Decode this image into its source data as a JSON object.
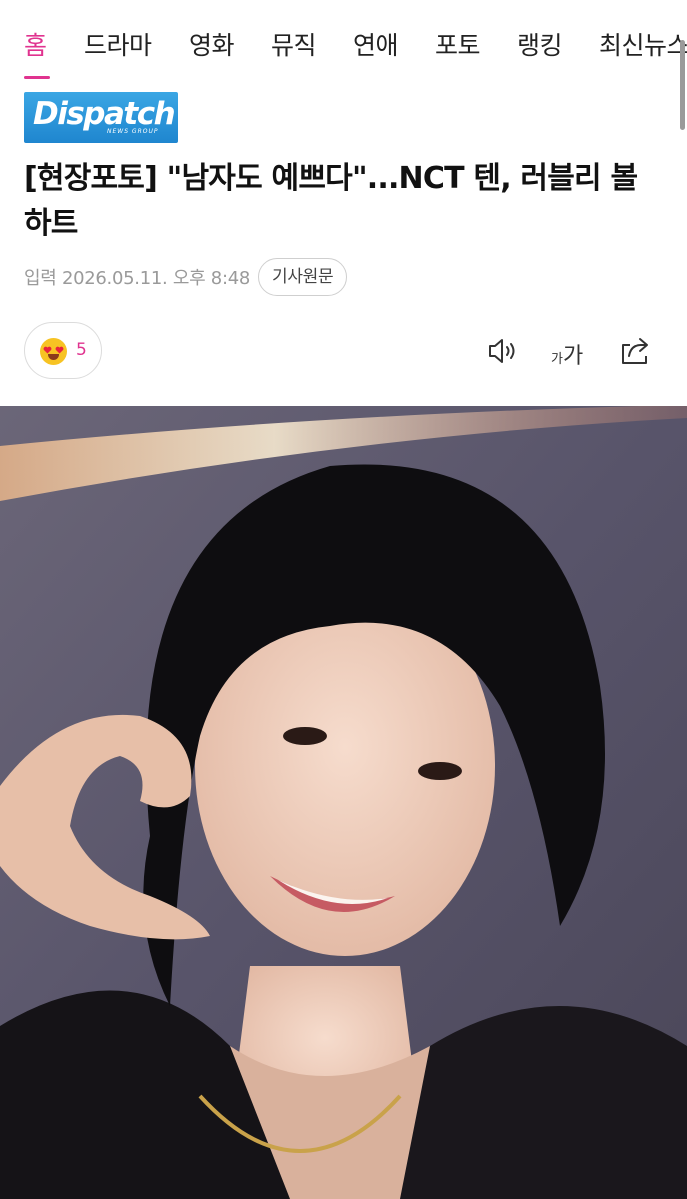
{
  "nav": {
    "items": [
      {
        "label": "홈",
        "active": true
      },
      {
        "label": "드라마"
      },
      {
        "label": "영화"
      },
      {
        "label": "뮤직"
      },
      {
        "label": "연애"
      },
      {
        "label": "포토"
      },
      {
        "label": "랭킹"
      },
      {
        "label": "최신뉴스"
      }
    ],
    "accent_color": "#e0338f"
  },
  "logo": {
    "name": "Dispatch",
    "tagline": "NEWS GROUP",
    "color": "#2b96da"
  },
  "article": {
    "headline": "[현장포토] \"남자도 예쁘다\"...NCT 텐, 러블리 볼하트",
    "published": "입력 2026.05.11. 오후 8:48",
    "source_button": "기사원문"
  },
  "reaction": {
    "emoji": "heart-eyes",
    "count": "5"
  },
  "tools": {
    "audio_icon": "speaker-icon",
    "font_size": {
      "small": "가",
      "large": "가"
    },
    "share_icon": "share-icon"
  },
  "photo": {
    "icon": "person-photo"
  }
}
